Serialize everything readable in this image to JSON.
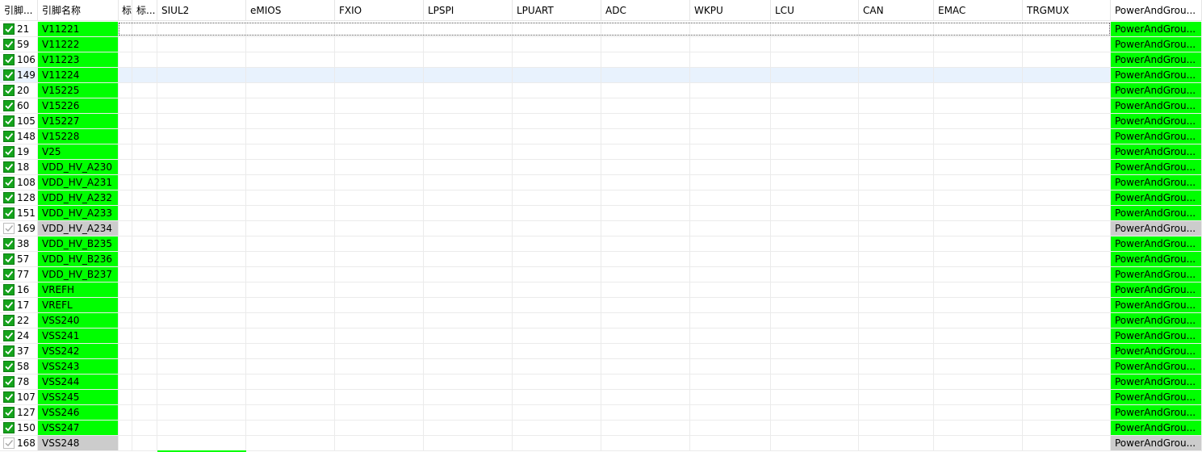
{
  "columns": [
    {
      "key": "pin",
      "label": "引脚..."
    },
    {
      "key": "name",
      "label": "引脚名称"
    },
    {
      "key": "c3",
      "label": "标"
    },
    {
      "key": "c4",
      "label": "标..."
    },
    {
      "key": "SIUL2",
      "label": "SIUL2"
    },
    {
      "key": "eMIOS",
      "label": "eMIOS"
    },
    {
      "key": "FXIO",
      "label": "FXIO"
    },
    {
      "key": "LPSPI",
      "label": "LPSPI"
    },
    {
      "key": "LPUART",
      "label": "LPUART"
    },
    {
      "key": "ADC",
      "label": "ADC"
    },
    {
      "key": "WKPU",
      "label": "WKPU"
    },
    {
      "key": "LCU",
      "label": "LCU"
    },
    {
      "key": "CAN",
      "label": "CAN"
    },
    {
      "key": "EMAC",
      "label": "EMAC"
    },
    {
      "key": "TRGMUX",
      "label": "TRGMUX"
    },
    {
      "key": "power",
      "label": "PowerAndGrou..."
    }
  ],
  "sort_indicator": "^",
  "rows": [
    {
      "pin": "21",
      "name": "V11221",
      "power": "PowerAndGrou...",
      "checked": true,
      "status": "green"
    },
    {
      "pin": "59",
      "name": "V11222",
      "power": "PowerAndGrou...",
      "checked": true,
      "status": "green"
    },
    {
      "pin": "106",
      "name": "V11223",
      "power": "PowerAndGrou...",
      "checked": true,
      "status": "green"
    },
    {
      "pin": "149",
      "name": "V11224",
      "power": "PowerAndGrou...",
      "checked": true,
      "status": "green",
      "selected": true
    },
    {
      "pin": "20",
      "name": "V15225",
      "power": "PowerAndGrou...",
      "checked": true,
      "status": "green"
    },
    {
      "pin": "60",
      "name": "V15226",
      "power": "PowerAndGrou...",
      "checked": true,
      "status": "green"
    },
    {
      "pin": "105",
      "name": "V15227",
      "power": "PowerAndGrou...",
      "checked": true,
      "status": "green"
    },
    {
      "pin": "148",
      "name": "V15228",
      "power": "PowerAndGrou...",
      "checked": true,
      "status": "green"
    },
    {
      "pin": "19",
      "name": "V25",
      "power": "PowerAndGrou...",
      "checked": true,
      "status": "green"
    },
    {
      "pin": "18",
      "name": "VDD_HV_A230",
      "power": "PowerAndGrou...",
      "checked": true,
      "status": "green"
    },
    {
      "pin": "108",
      "name": "VDD_HV_A231",
      "power": "PowerAndGrou...",
      "checked": true,
      "status": "green"
    },
    {
      "pin": "128",
      "name": "VDD_HV_A232",
      "power": "PowerAndGrou...",
      "checked": true,
      "status": "green"
    },
    {
      "pin": "151",
      "name": "VDD_HV_A233",
      "power": "PowerAndGrou...",
      "checked": true,
      "status": "green"
    },
    {
      "pin": "169",
      "name": "VDD_HV_A234",
      "power": "PowerAndGrou...",
      "checked": false,
      "status": "gray"
    },
    {
      "pin": "38",
      "name": "VDD_HV_B235",
      "power": "PowerAndGrou...",
      "checked": true,
      "status": "green"
    },
    {
      "pin": "57",
      "name": "VDD_HV_B236",
      "power": "PowerAndGrou...",
      "checked": true,
      "status": "green"
    },
    {
      "pin": "77",
      "name": "VDD_HV_B237",
      "power": "PowerAndGrou...",
      "checked": true,
      "status": "green"
    },
    {
      "pin": "16",
      "name": "VREFH",
      "power": "PowerAndGrou...",
      "checked": true,
      "status": "green"
    },
    {
      "pin": "17",
      "name": "VREFL",
      "power": "PowerAndGrou...",
      "checked": true,
      "status": "green"
    },
    {
      "pin": "22",
      "name": "VSS240",
      "power": "PowerAndGrou...",
      "checked": true,
      "status": "green"
    },
    {
      "pin": "24",
      "name": "VSS241",
      "power": "PowerAndGrou...",
      "checked": true,
      "status": "green"
    },
    {
      "pin": "37",
      "name": "VSS242",
      "power": "PowerAndGrou...",
      "checked": true,
      "status": "green"
    },
    {
      "pin": "58",
      "name": "VSS243",
      "power": "PowerAndGrou...",
      "checked": true,
      "status": "green"
    },
    {
      "pin": "78",
      "name": "VSS244",
      "power": "PowerAndGrou...",
      "checked": true,
      "status": "green"
    },
    {
      "pin": "107",
      "name": "VSS245",
      "power": "PowerAndGrou...",
      "checked": true,
      "status": "green"
    },
    {
      "pin": "127",
      "name": "VSS246",
      "power": "PowerAndGrou...",
      "checked": true,
      "status": "green"
    },
    {
      "pin": "150",
      "name": "VSS247",
      "power": "PowerAndGrou...",
      "checked": true,
      "status": "green"
    },
    {
      "pin": "168",
      "name": "VSS248",
      "power": "PowerAndGrou...",
      "checked": false,
      "status": "gray"
    }
  ],
  "colors": {
    "green": "#00ff00",
    "gray": "#cccccc",
    "selected": "#e8f2fd",
    "check": "#15a31c"
  }
}
